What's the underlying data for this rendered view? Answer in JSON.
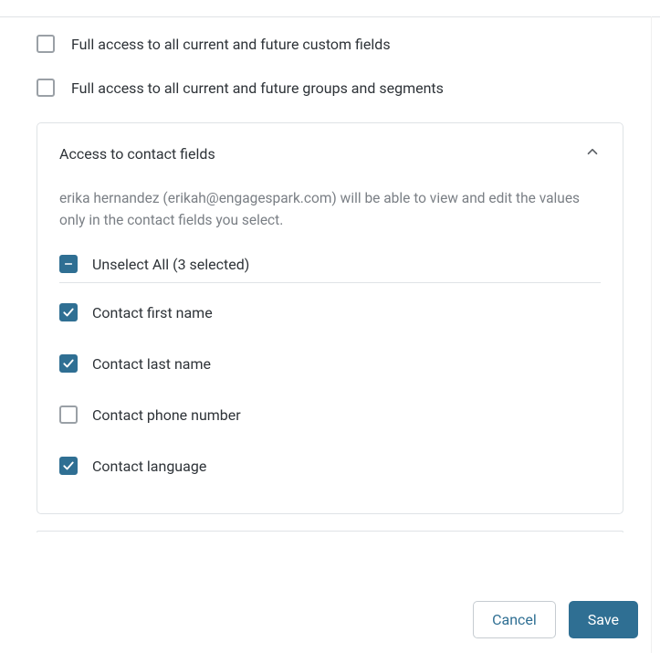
{
  "topOptions": {
    "customFields": {
      "label": "Full access to all current and future custom fields",
      "checked": false
    },
    "groupsSegments": {
      "label": "Full access to all current and future groups and segments",
      "checked": false
    }
  },
  "panel": {
    "title": "Access to contact fields",
    "description": "erika hernandez (erikah@engagespark.com) will be able to view and edit the values only in the contact fields you select.",
    "unselectLabel": "Unselect All (3 selected)",
    "fields": [
      {
        "label": "Contact first name",
        "checked": true
      },
      {
        "label": "Contact last name",
        "checked": true
      },
      {
        "label": "Contact phone number",
        "checked": false
      },
      {
        "label": "Contact language",
        "checked": true
      }
    ]
  },
  "buttons": {
    "cancel": "Cancel",
    "save": "Save"
  }
}
